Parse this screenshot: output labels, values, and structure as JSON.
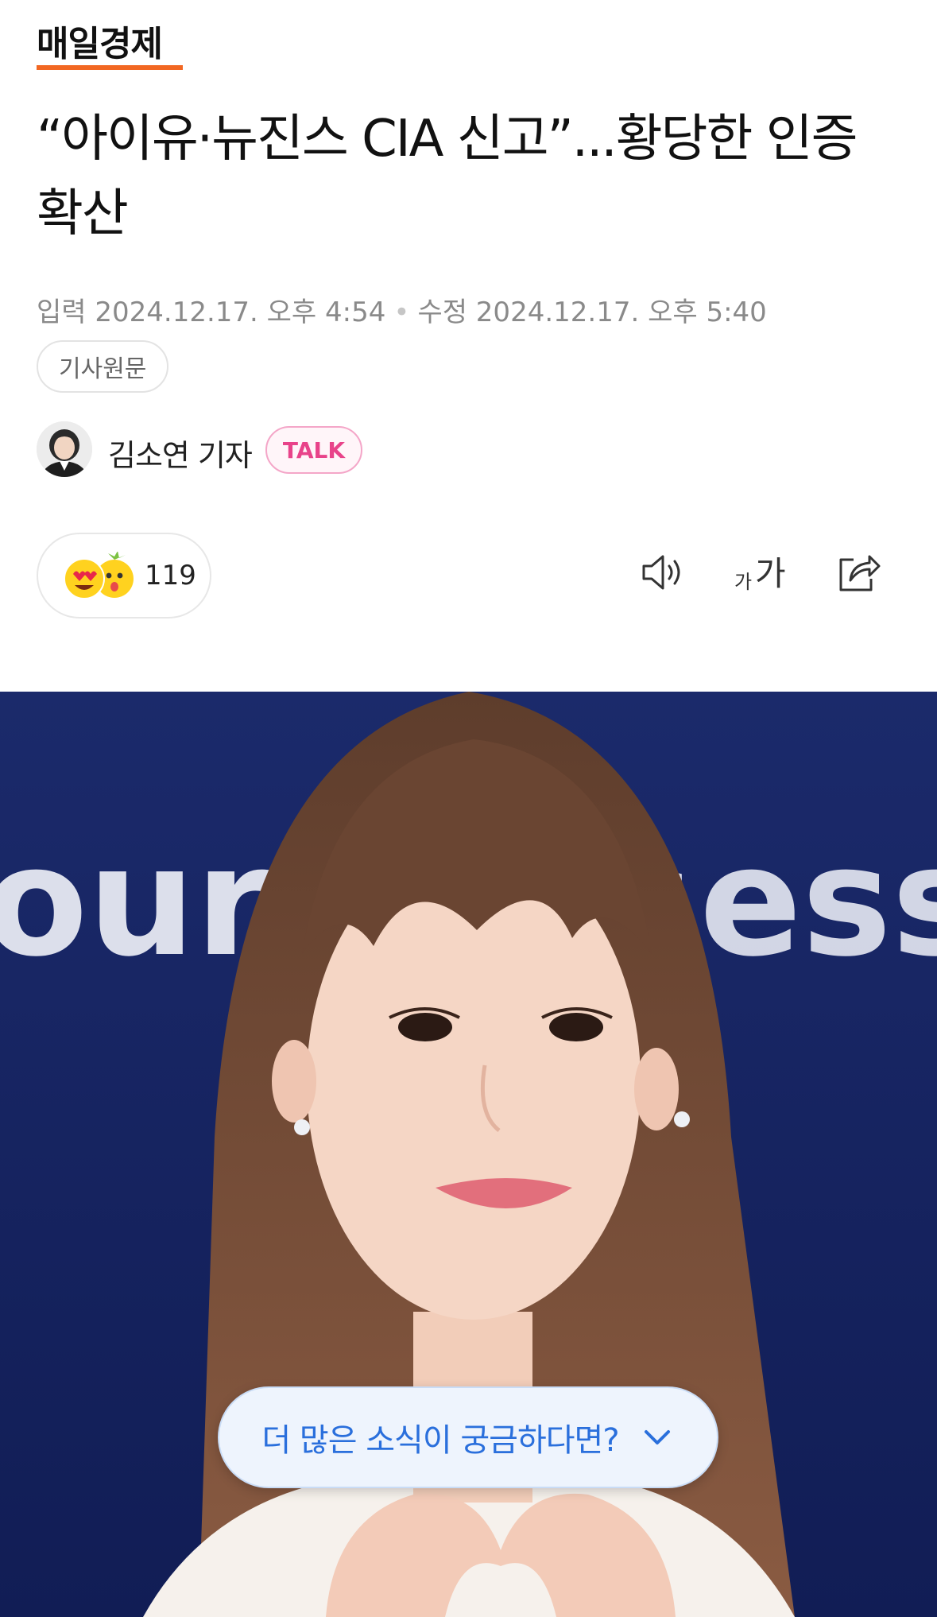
{
  "press": {
    "name": "매일경제",
    "brand_color": "#f26722"
  },
  "article": {
    "headline": "“아이유·뉴진스 CIA 신고”...황당한 인증 확산",
    "published": "입력 2024.12.17. 오후 4:54",
    "modified": "수정 2024.12.17. 오후 5:40",
    "original_link_label": "기사원문"
  },
  "reporter": {
    "name": "김소연 기자",
    "talk_label": "TALK",
    "talk_color": "#e8438a"
  },
  "reactions": {
    "count": "119",
    "emojis": [
      "heart-eyes-emoji",
      "surprised-face-emoji"
    ]
  },
  "toolbar": {
    "icons": [
      "speaker-icon",
      "font-size-icon",
      "share-icon"
    ]
  },
  "photo": {
    "backdrop_text": "ours ess"
  },
  "more_news": {
    "label": "더 많은 소식이 궁금하다면?",
    "accent": "#2a6fdc"
  }
}
